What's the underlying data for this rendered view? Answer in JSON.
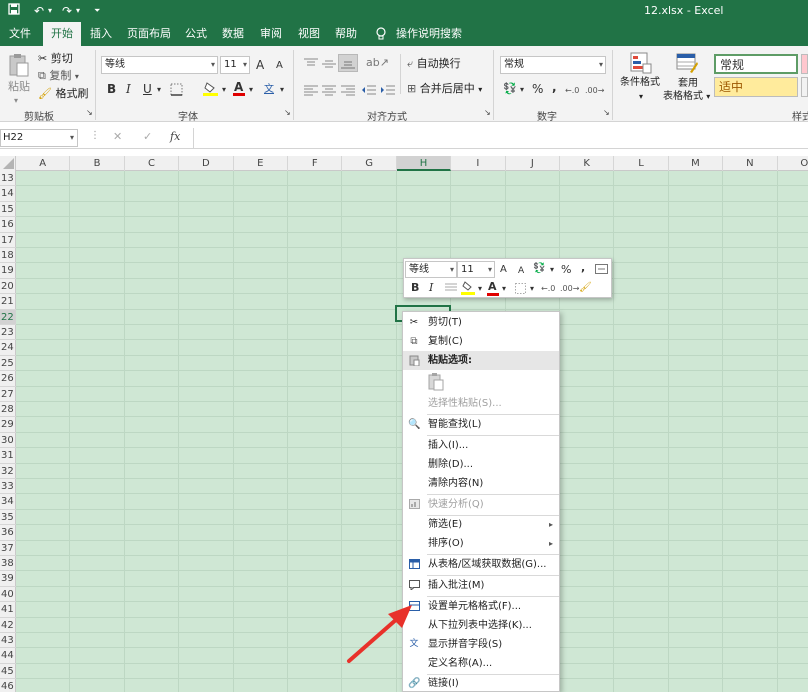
{
  "title_bar": {
    "file_name": "12.xlsx",
    "app_name": "Excel",
    "separator": "-"
  },
  "quick_access": {
    "save_icon": "save-icon",
    "undo_icon": "undo-icon",
    "redo_icon": "redo-icon",
    "customize_icon": "customize-arrow-icon"
  },
  "menu": {
    "items": [
      "文件",
      "开始",
      "插入",
      "页面布局",
      "公式",
      "数据",
      "审阅",
      "视图",
      "帮助"
    ],
    "active_index": 1,
    "tell_me": "操作说明搜索"
  },
  "ribbon": {
    "clipboard": {
      "paste": "粘贴",
      "cut": "剪切",
      "copy": "复制",
      "format_painter": "格式刷",
      "group_label": "剪贴板"
    },
    "font": {
      "name": "等线",
      "size": "11",
      "bold": "B",
      "italic": "I",
      "underline": "U",
      "font_color_label": "A",
      "grow": "A",
      "shrink": "A",
      "phonetic": "文",
      "group_label": "字体"
    },
    "alignment": {
      "wrap": "自动换行",
      "merge": "合并后居中",
      "group_label": "对齐方式"
    },
    "number": {
      "format": "常规",
      "percent": "%",
      "comma": ",",
      "group_label": "数字"
    },
    "styles": {
      "conditional": "条件格式",
      "table_line1": "套用",
      "table_line2": "表格格式",
      "normal": "常规",
      "neutral": "适中",
      "group_label": "样式"
    }
  },
  "formula_bar": {
    "name_box": "H22",
    "cancel": "✕",
    "enter": "✓",
    "fx": "fx",
    "value": ""
  },
  "grid": {
    "columns": [
      "A",
      "B",
      "C",
      "D",
      "E",
      "F",
      "G",
      "H",
      "I",
      "J",
      "K",
      "L",
      "M",
      "N",
      "O"
    ],
    "rows": [
      "13",
      "14",
      "15",
      "16",
      "17",
      "18",
      "19",
      "20",
      "21",
      "22",
      "23",
      "24",
      "25",
      "26",
      "27",
      "28",
      "29",
      "30",
      "31",
      "32",
      "33",
      "34",
      "35",
      "36",
      "37",
      "38",
      "39",
      "40",
      "41",
      "42",
      "43",
      "44",
      "45",
      "46"
    ],
    "selected_column": "H",
    "selected_row": "22"
  },
  "mini_toolbar": {
    "font": "等线",
    "size": "11",
    "grow": "A",
    "shrink": "A",
    "percent": "%",
    "comma": ",",
    "bold": "B",
    "italic": "I",
    "font_color": "A"
  },
  "context_menu": {
    "cut": "剪切(T)",
    "copy": "复制(C)",
    "paste_options": "粘贴选项:",
    "paste_special": "选择性粘贴(S)...",
    "smart_lookup": "智能查找(L)",
    "insert": "插入(I)...",
    "delete": "删除(D)...",
    "clear": "清除内容(N)",
    "quick_analysis": "快速分析(Q)",
    "filter": "筛选(E)",
    "sort": "排序(O)",
    "from_table": "从表格/区域获取数据(G)...",
    "insert_comment": "插入批注(M)",
    "format_cells": "设置单元格格式(F)...",
    "pick_list": "从下拉列表中选择(K)...",
    "phonetic": "显示拼音字段(S)",
    "define_name": "定义名称(A)...",
    "link": "链接(I)"
  },
  "colors": {
    "excel_green": "#217346",
    "sheet_fill": "#cfe7d4",
    "arrow": "#e8312a"
  }
}
